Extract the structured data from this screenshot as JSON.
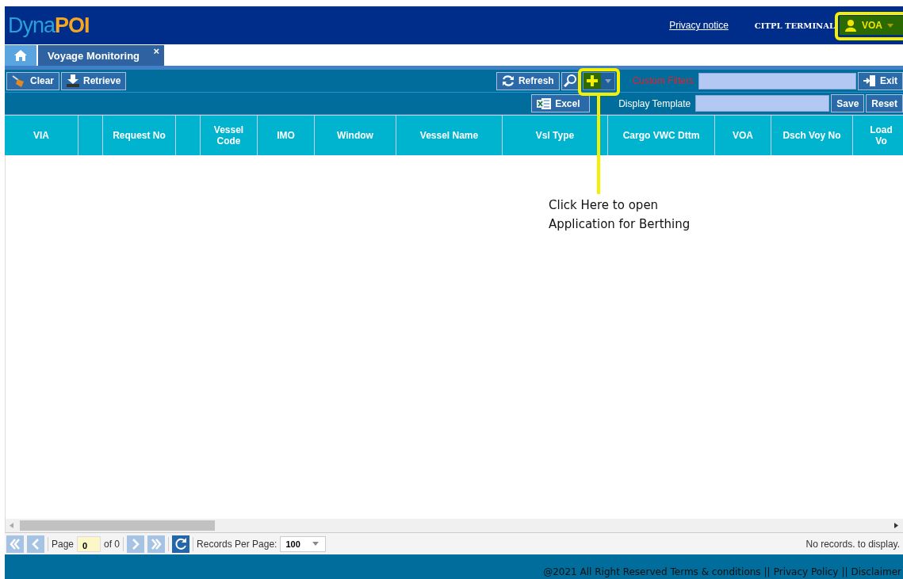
{
  "header": {
    "logo": {
      "part1": "Dyna",
      "part2": "POI"
    },
    "privacy_link": "Privacy notice",
    "terminal": "CITPL TERMINAL",
    "user": {
      "label": "VOA"
    }
  },
  "tabs": [
    {
      "kind": "home",
      "selected": false
    },
    {
      "kind": "page",
      "label": "Voyage Monitoring",
      "close": "×",
      "selected": true
    }
  ],
  "toolbar": {
    "left": [
      {
        "kind": "clear",
        "label": "Clear"
      },
      {
        "kind": "retrieve",
        "label": "Retrieve"
      }
    ],
    "refresh": "Refresh",
    "custom_filters_label": "Custom Filters",
    "exit": "Exit"
  },
  "toolbar2": {
    "excel": "Excel",
    "display_template_label": "Display Template",
    "save": "Save",
    "reset": "Reset"
  },
  "table": {
    "columns": [
      {
        "kind": "text",
        "label": "VIA"
      },
      {
        "kind": "blank"
      },
      {
        "kind": "text",
        "label": "Request No"
      },
      {
        "kind": "blank"
      },
      {
        "kind": "text",
        "label": "Vessel Code"
      },
      {
        "kind": "text",
        "label": "IMO"
      },
      {
        "kind": "text",
        "label": "Window"
      },
      {
        "kind": "text",
        "label": "Vessel Name"
      },
      {
        "kind": "text",
        "label": "Vsl Type"
      },
      {
        "kind": "text",
        "label": "Cargo VWC Dttm"
      },
      {
        "kind": "text",
        "label": "VOA"
      },
      {
        "kind": "text",
        "label": "Dsch Voy No"
      },
      {
        "kind": "text",
        "label": "Load Vo"
      }
    ]
  },
  "pager": {
    "page_label": "Page",
    "page_value": "0",
    "of": "of 0",
    "records_label": "Records Per Page:",
    "records_value": "100",
    "status": "No records. to display.",
    "first_disabled": true,
    "prev_disabled": true,
    "next_disabled": true,
    "last_disabled": true
  },
  "footer": {
    "copyright": "@2021 All Right Reserved",
    "links": [
      "Terms & conditions",
      "Privacy Policy",
      "Disclaimer"
    ],
    "separator": "||"
  },
  "annotation": {
    "lines": [
      "Click Here to open",
      "Application for Berthing"
    ]
  }
}
